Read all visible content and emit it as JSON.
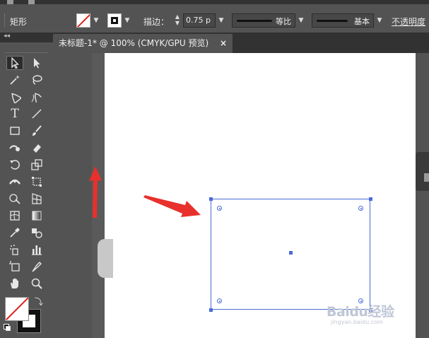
{
  "control_bar": {
    "tool_name": "矩形",
    "stroke_label": "描边：",
    "stroke_width": "0.75 p",
    "variable_width_profile": "等比",
    "brush_definition": "基本",
    "opacity_label": "不透明度"
  },
  "colors": {
    "selection": "#4a6bd8",
    "annotation_arrow": "#e8302c",
    "none_swatch_slash": "#e02020",
    "ui_background": "#535353",
    "artboard": "#ffffff"
  },
  "tools": [
    {
      "name": "selection-tool",
      "icon": "arrow-outline"
    },
    {
      "name": "direct-selection-tool",
      "icon": "arrow-filled"
    },
    {
      "name": "magic-wand-tool",
      "icon": "magic-wand"
    },
    {
      "name": "lasso-tool",
      "icon": "lasso"
    },
    {
      "name": "pen-tool",
      "icon": "pen"
    },
    {
      "name": "curvature-tool",
      "icon": "curvature-pen"
    },
    {
      "name": "type-tool",
      "icon": "T"
    },
    {
      "name": "line-segment-tool",
      "icon": "line"
    },
    {
      "name": "rectangle-tool",
      "icon": "rectangle"
    },
    {
      "name": "paintbrush-tool",
      "icon": "brush"
    },
    {
      "name": "shaper-tool",
      "icon": "shaper"
    },
    {
      "name": "eraser-tool",
      "icon": "eraser"
    },
    {
      "name": "rotate-tool",
      "icon": "rotate"
    },
    {
      "name": "scale-tool",
      "icon": "scale"
    },
    {
      "name": "width-tool",
      "icon": "width"
    },
    {
      "name": "free-transform-tool",
      "icon": "free-transform"
    },
    {
      "name": "shape-builder-tool",
      "icon": "shape-builder"
    },
    {
      "name": "perspective-grid-tool",
      "icon": "perspective-grid"
    },
    {
      "name": "mesh-tool",
      "icon": "mesh"
    },
    {
      "name": "gradient-tool",
      "icon": "gradient"
    },
    {
      "name": "eyedropper-tool",
      "icon": "eyedropper"
    },
    {
      "name": "blend-tool",
      "icon": "blend"
    },
    {
      "name": "symbol-sprayer-tool",
      "icon": "symbol-sprayer"
    },
    {
      "name": "column-graph-tool",
      "icon": "column-graph"
    },
    {
      "name": "artboard-tool",
      "icon": "artboard"
    },
    {
      "name": "slice-tool",
      "icon": "slice"
    },
    {
      "name": "hand-tool",
      "icon": "hand"
    },
    {
      "name": "zoom-tool",
      "icon": "zoom"
    }
  ],
  "document": {
    "tab_title": "未标题-1* @ 100% (CMYK/GPU 预览)",
    "close_glyph": "×"
  },
  "watermark": {
    "logo": "Baidu经验",
    "url": "jingyan.baidu.com"
  }
}
